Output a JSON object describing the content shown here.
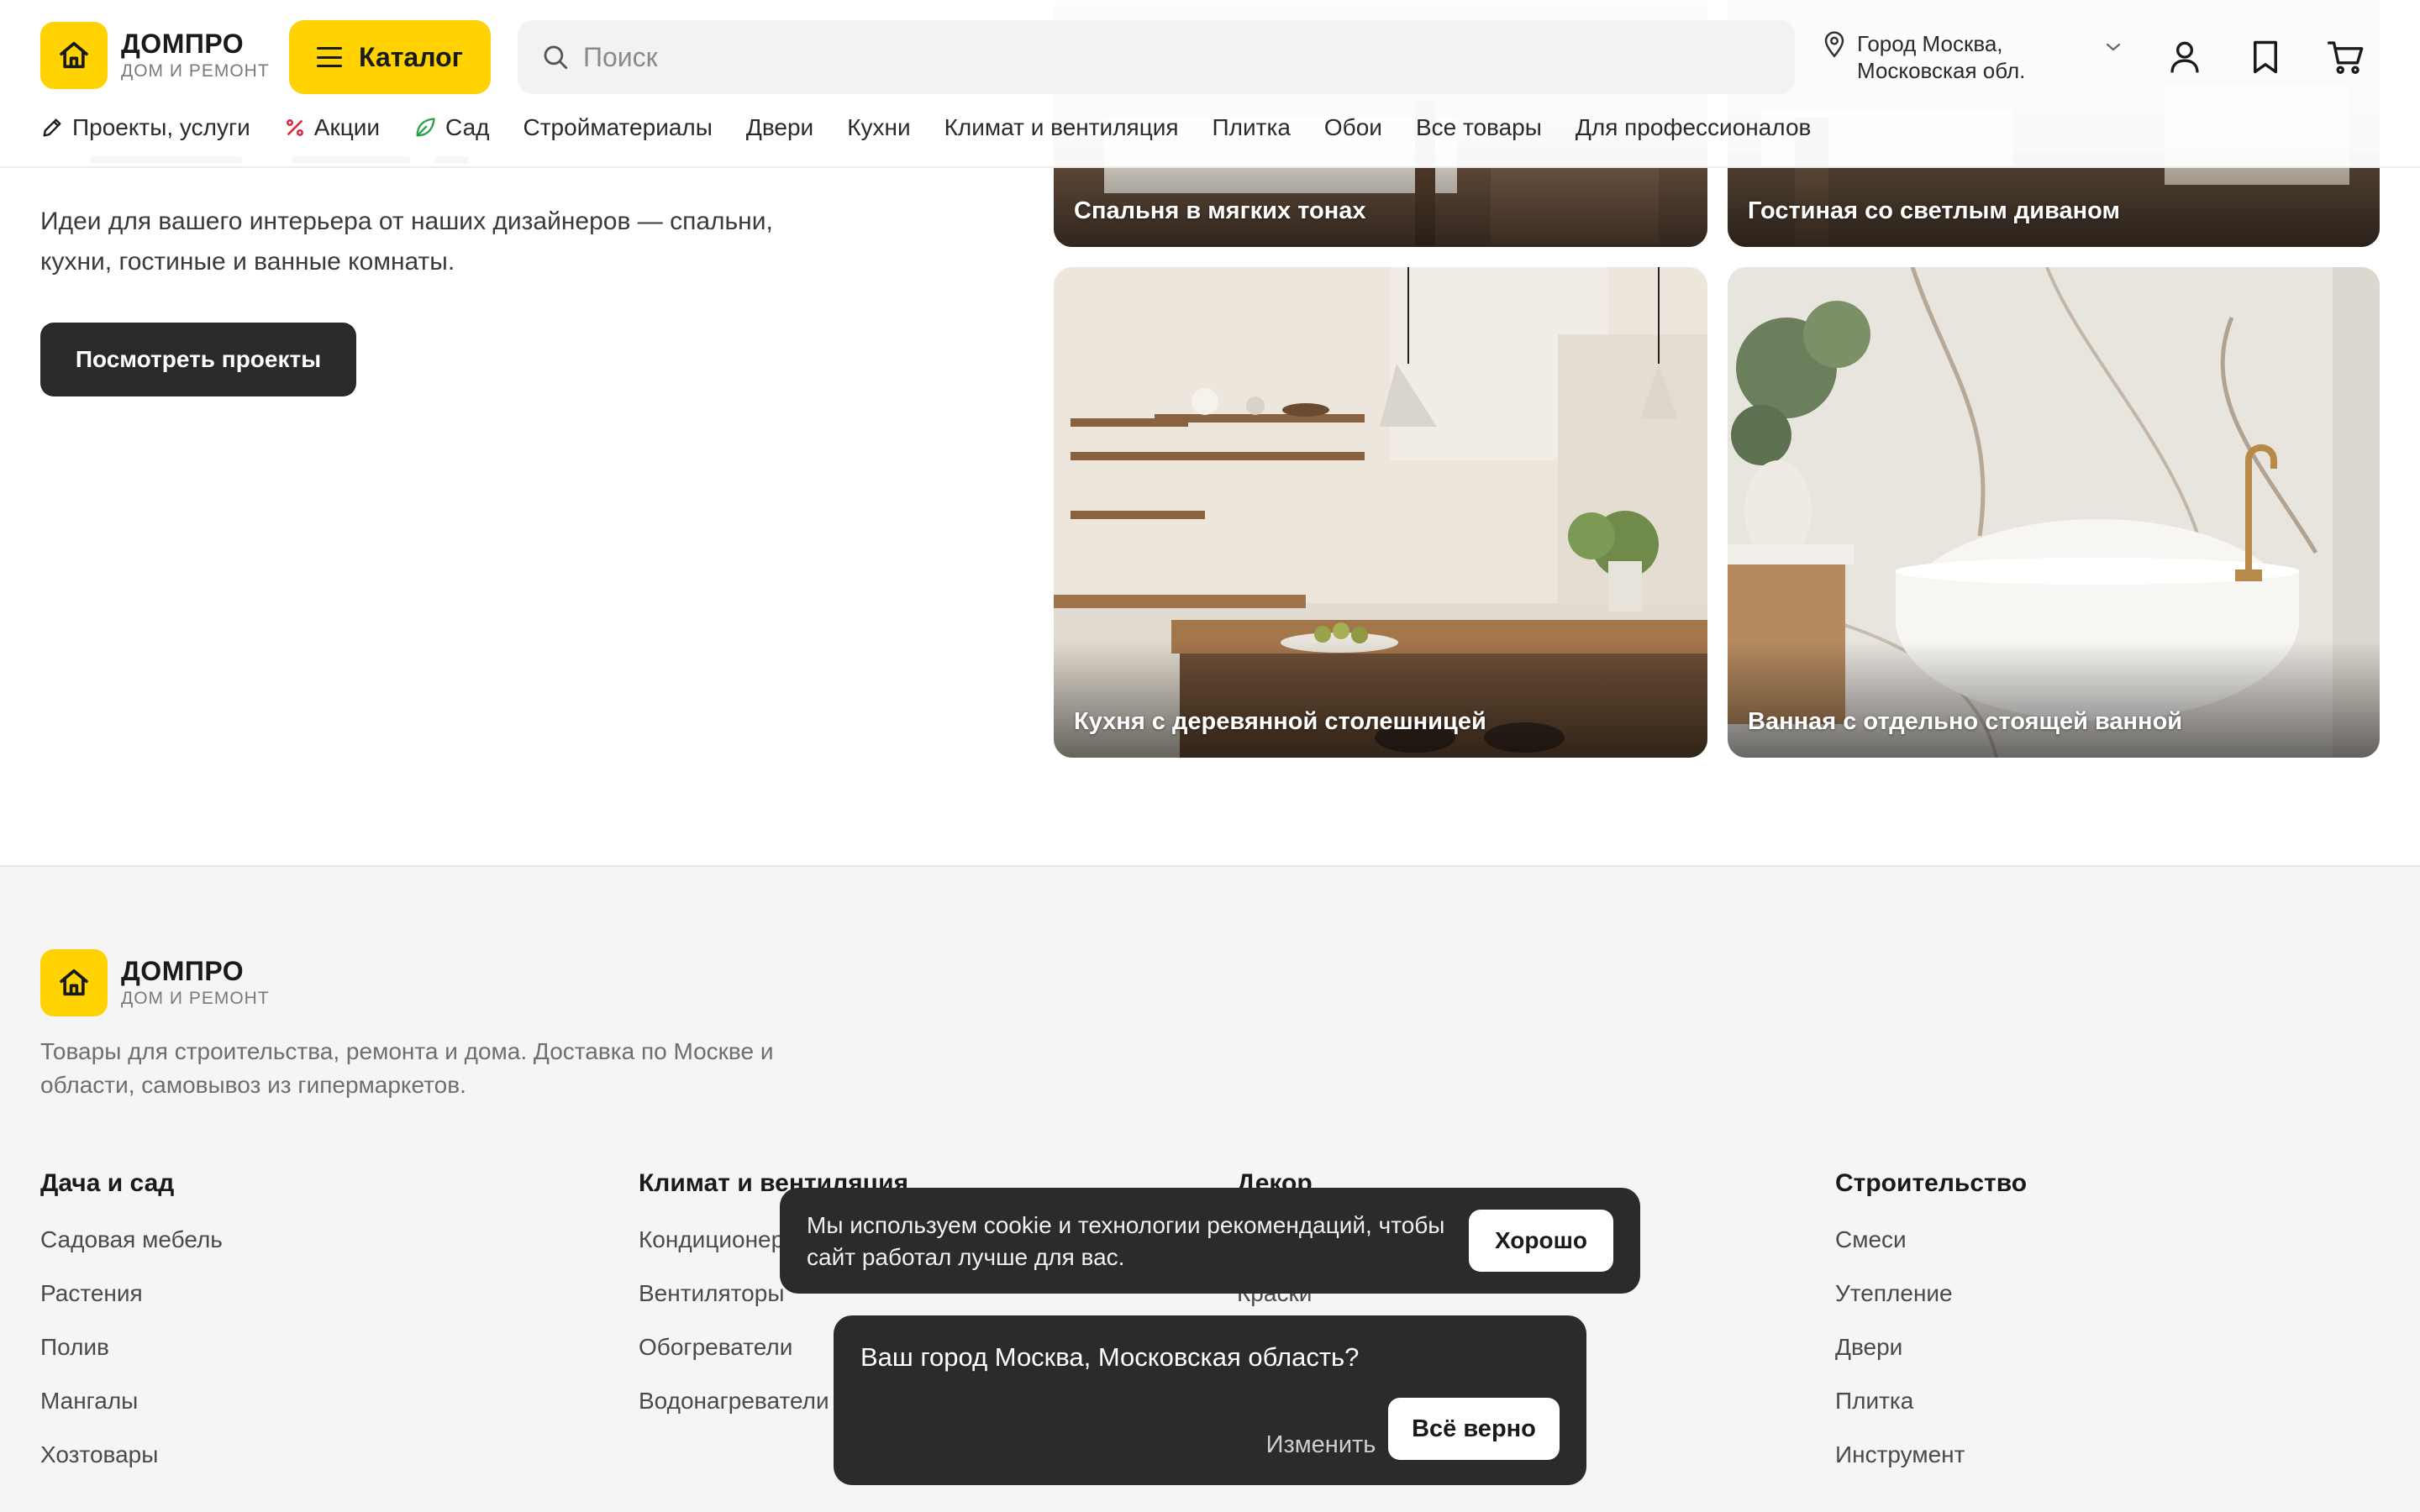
{
  "header": {
    "logo_title": "ДОМПРО",
    "logo_sub": "ДОМ И РЕМОНТ",
    "catalog_label": "Каталог",
    "search_placeholder": "Поиск",
    "city_line1": "Город Москва,",
    "city_line2": "Московская обл.",
    "icons": [
      "home-icon",
      "menu-icon",
      "search-icon",
      "location-pin-icon",
      "chevron-down-icon",
      "user-icon",
      "bookmark-icon",
      "cart-icon"
    ],
    "accent_color": "#ffd200"
  },
  "nav": {
    "items": [
      {
        "label": "Проекты, услуги",
        "icon": "pencil-icon"
      },
      {
        "label": "Акции",
        "icon": "percent-icon",
        "icon_color": "#e0283a"
      },
      {
        "label": "Сад",
        "icon": "leaf-icon",
        "icon_color": "#2e9e4f"
      },
      {
        "label": "Стройматериалы"
      },
      {
        "label": "Двери"
      },
      {
        "label": "Кухни"
      },
      {
        "label": "Климат и вентиляция"
      },
      {
        "label": "Плитка"
      },
      {
        "label": "Обои"
      },
      {
        "label": "Все товары"
      },
      {
        "label": "Для профессионалов"
      }
    ]
  },
  "hero": {
    "description": "Идеи для вашего интерьера от наших дизайнеров — спальни, кухни, гостиные и ванные комнаты.",
    "button_label": "Посмотреть проекты",
    "cards": [
      {
        "caption": "Спальня в мягких тонах"
      },
      {
        "caption": "Гостиная со светлым диваном"
      },
      {
        "caption": "Кухня с деревянной столешницей"
      },
      {
        "caption": "Ванная с отдельно стоящей ванной"
      }
    ]
  },
  "footer": {
    "logo_title": "ДОМПРО",
    "logo_sub": "ДОМ И РЕМОНТ",
    "description": "Товары для строительства, ремонта и дома. Доставка по Москве и области, самовывоз из гипермаркетов.",
    "columns": [
      {
        "title": "Дача и сад",
        "items": [
          "Садовая мебель",
          "Растения",
          "Полив",
          "Мангалы",
          "Хозтовары"
        ]
      },
      {
        "title": "Климат и вентиляция",
        "items": [
          "Кондиционеры",
          "Вентиляторы",
          "Обогреватели",
          "Водонагреватели"
        ]
      },
      {
        "title": "Декор",
        "items": [
          "Краски"
        ]
      },
      {
        "title": "Строительство",
        "items": [
          "Смеси",
          "Утепление",
          "Двери",
          "Плитка",
          "Инструмент"
        ]
      }
    ]
  },
  "cookie": {
    "text": "Мы используем cookie и технологии рекомендаций, чтобы сайт работал лучше для вас.",
    "button_label": "Хорошо"
  },
  "city_popup": {
    "question": "Ваш город Москва, Московская область?",
    "change_label": "Изменить",
    "confirm_label": "Всё верно"
  }
}
